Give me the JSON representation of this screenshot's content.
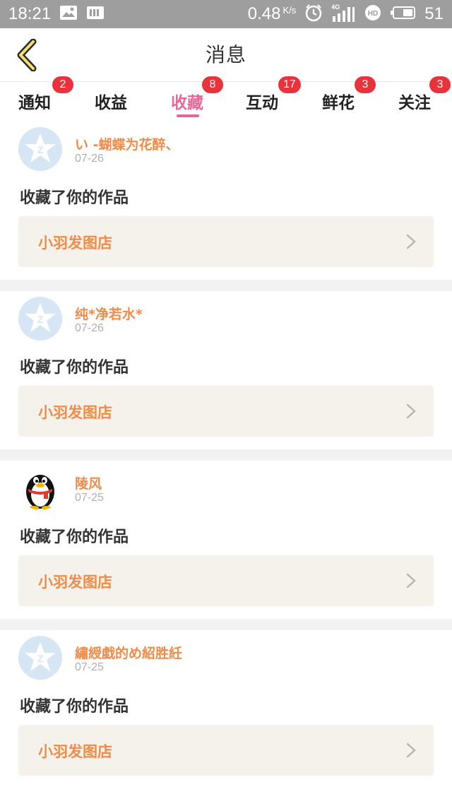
{
  "status_bar": {
    "time": "18:21",
    "network_speed": "0.48",
    "network_unit": "K/s",
    "network_type": "4G",
    "battery_level": "51",
    "icons": [
      "image-icon",
      "sim-card-icon",
      "alarm-icon",
      "signal-icon",
      "hd-icon",
      "battery-icon"
    ]
  },
  "header": {
    "title": "消息",
    "back_icon": "chevron-left-icon"
  },
  "tabs": [
    {
      "label": "通知",
      "badge": "2"
    },
    {
      "label": "收益",
      "badge": ""
    },
    {
      "label": "收藏",
      "badge": "8",
      "active": true
    },
    {
      "label": "互动",
      "badge": "17"
    },
    {
      "label": "鲜花",
      "badge": "3"
    },
    {
      "label": "关注",
      "badge": "3"
    }
  ],
  "colors": {
    "accent_pink": "#e8679a",
    "badge_red": "#e8323c",
    "name_orange": "#ef8c4a",
    "card_bg": "#f4f2ea"
  },
  "feed": [
    {
      "username": "い -蝴蝶为花醉、",
      "date": "07-26",
      "action": "收藏了你的作品",
      "work_title": "小羽发图店",
      "avatar": "default-avatar-icon"
    },
    {
      "username": "纯*净若水*",
      "date": "07-26",
      "action": "收藏了你的作品",
      "work_title": "小羽发图店",
      "avatar": "default-avatar-icon"
    },
    {
      "username": "陵风",
      "date": "07-25",
      "action": "收藏了你的作品",
      "work_title": "小羽发图店",
      "avatar": "penguin-avatar-icon"
    },
    {
      "username": "繡綬戱的め紹胜紝",
      "date": "07-25",
      "action": "收藏了你的作品",
      "work_title": "小羽发图店",
      "avatar": "default-avatar-icon"
    }
  ]
}
